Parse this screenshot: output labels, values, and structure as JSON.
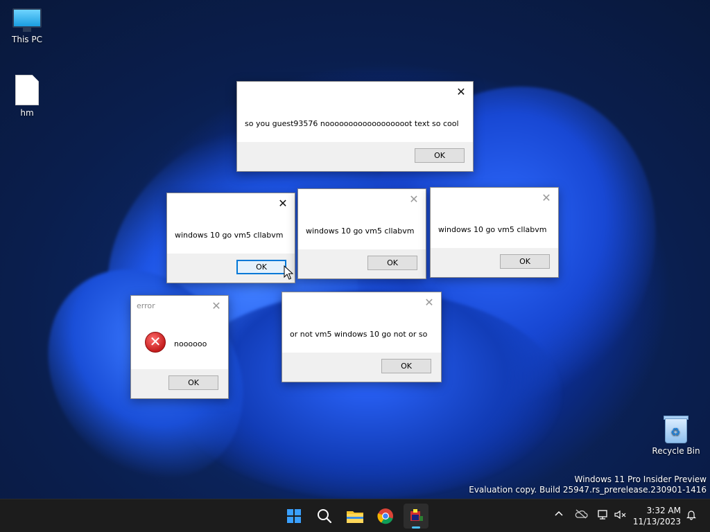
{
  "desktop": {
    "icons": [
      {
        "label": "This PC"
      },
      {
        "label": "hm"
      },
      {
        "label": "Recycle Bin"
      }
    ],
    "watermark": {
      "line1": "Windows 11 Pro Insider Preview",
      "line2": "Evaluation copy. Build 25947.rs_prerelease.230901-1416"
    }
  },
  "dialogs": {
    "d1": {
      "title": "",
      "message": "so you guest93576 noooooooooooooooooot text so cool",
      "ok": "OK"
    },
    "d2": {
      "title": "",
      "message": "windows 10 go vm5 cllabvm",
      "ok": "OK"
    },
    "d3": {
      "title": "",
      "message": "windows 10 go vm5 cllabvm",
      "ok": "OK"
    },
    "d4": {
      "title": "",
      "message": "windows 10 go vm5 cllabvm",
      "ok": "OK"
    },
    "d5": {
      "title": "error",
      "message": "noooooo",
      "ok": "OK"
    },
    "d6": {
      "title": "",
      "message": "or not vm5 windows 10 go not or so",
      "ok": "OK"
    }
  },
  "icons": {
    "close": "✕",
    "error": "✕"
  },
  "taskbar": {
    "apps": [
      "start-icon",
      "search-icon",
      "file-explorer-icon",
      "chrome-icon",
      "active-app-icon"
    ],
    "clock": {
      "time": "3:32 AM",
      "date": "11/13/2023"
    }
  },
  "colors": {
    "accent": "#0078d7",
    "taskbar_bg": "#1c1c1c",
    "indicator": "#4cc2ff"
  }
}
